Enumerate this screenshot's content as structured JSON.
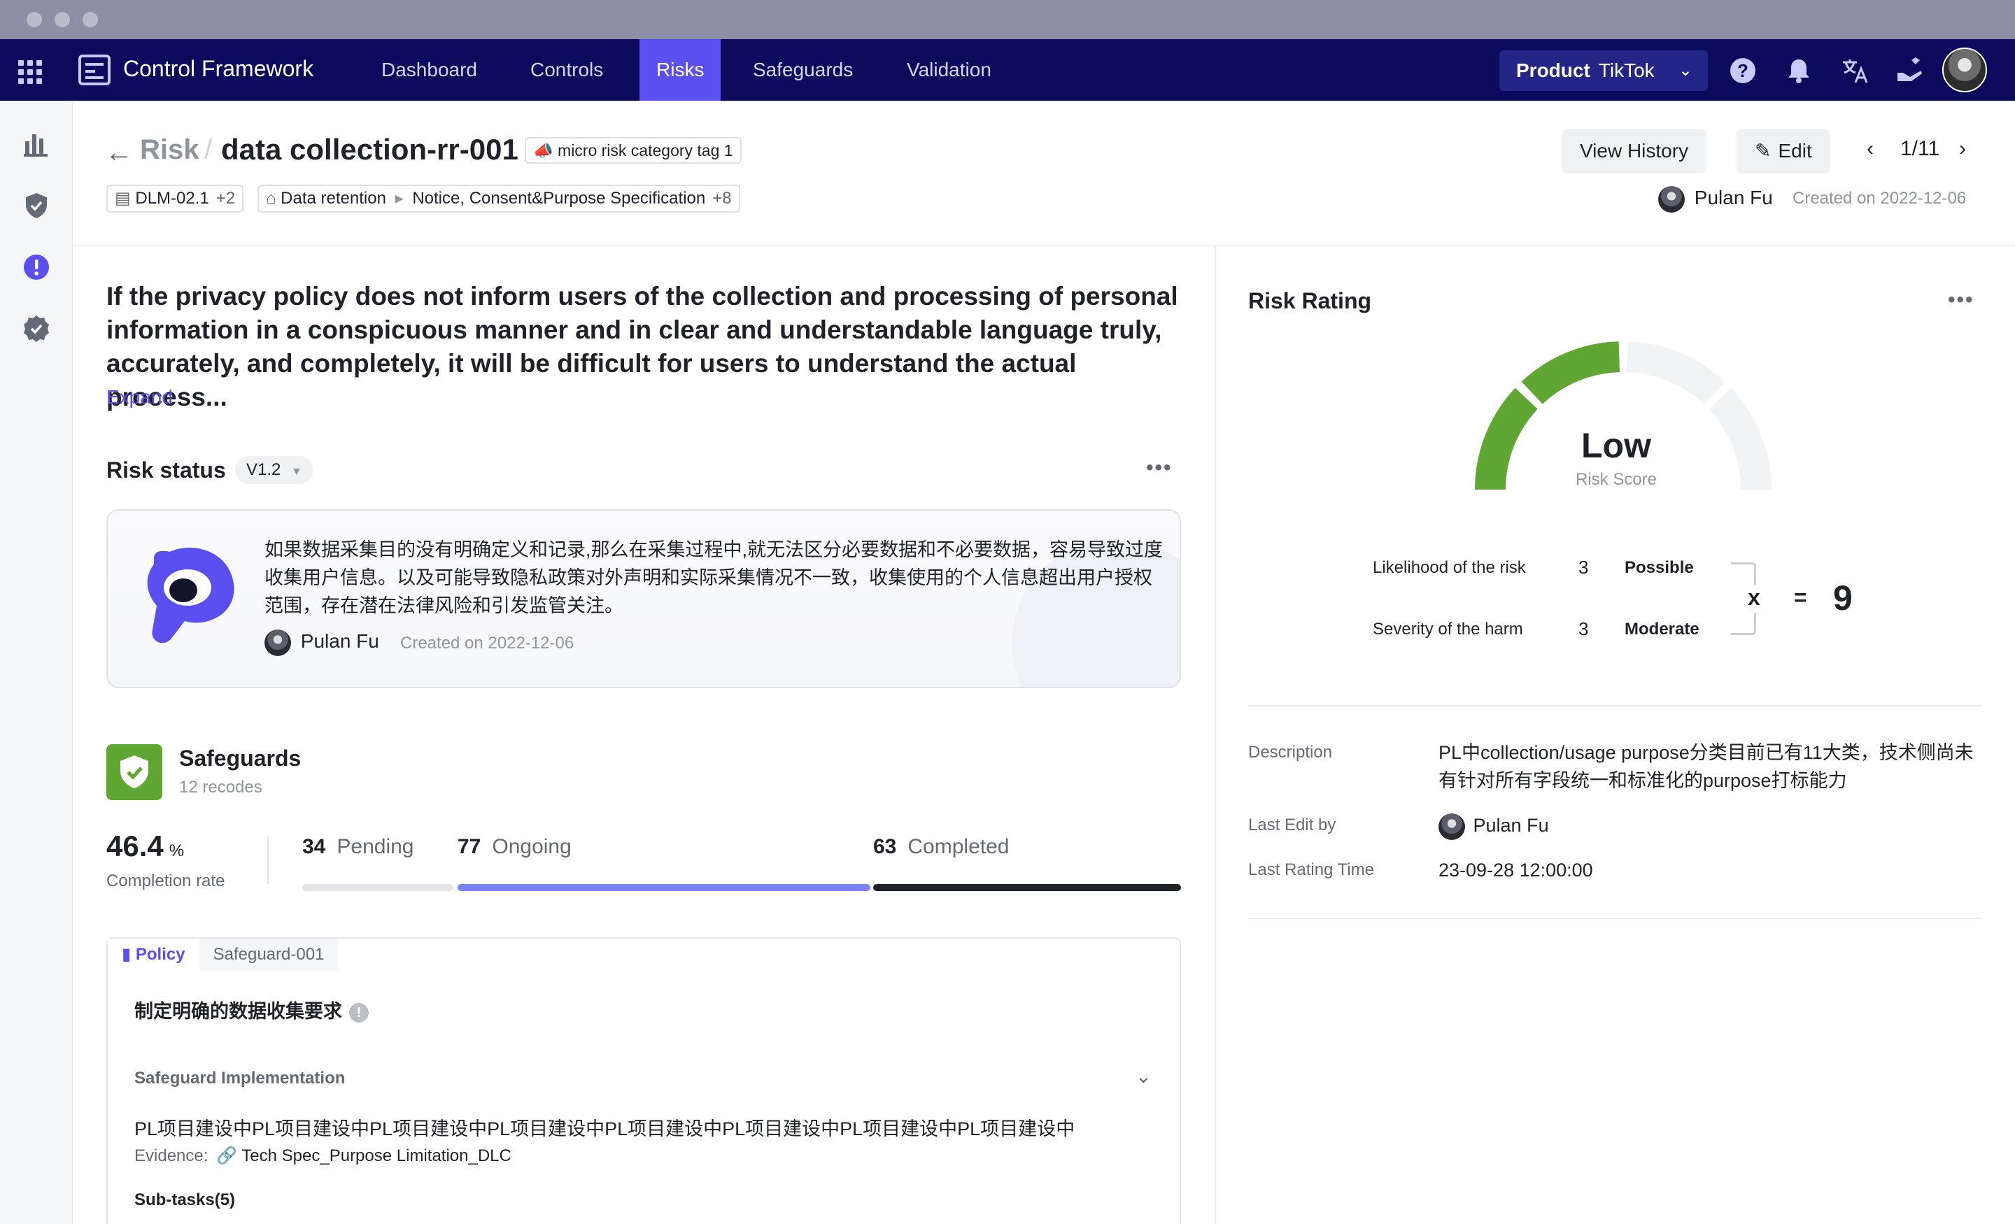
{
  "nav": {
    "app_name": "Control Framework",
    "tabs": [
      "Dashboard",
      "Controls",
      "Risks",
      "Safeguards",
      "Validation"
    ],
    "active_tab": "Risks",
    "product_label": "Product",
    "product_value": "TikTok"
  },
  "header": {
    "root": "Risk",
    "title": "data collection-rr-001",
    "category_tag": "micro risk category tag 1",
    "control_tag": "DLM-02.1",
    "control_tag_more": "+2",
    "path_start": "Data retention",
    "path_end": "Notice, Consent&Purpose Specification",
    "path_more": "+8",
    "view_history": "View History",
    "edit": "Edit",
    "pager": "1/11",
    "author": "Pulan Fu",
    "created": "Created on 2022-12-06"
  },
  "risk": {
    "description": "If the privacy policy does not inform users of the collection and processing of personal information in a conspicuous manner and in clear and understandable language truly, accurately, and completely, it will be difficult for users to understand the actual process...",
    "expand": "Expand"
  },
  "status": {
    "title": "Risk status",
    "version": "V1.2",
    "text": "如果数据采集目的没有明确定义和记录,那么在采集过程中,就无法区分必要数据和不必要数据，容易导致过度收集用户信息。以及可能导致隐私政策对外声明和实际采集情况不一致，收集使用的个人信息超出用户授权范围，存在潜在法律风险和引发监管关注。",
    "author": "Pulan Fu",
    "created": "Created on 2022-12-06"
  },
  "safeguards": {
    "title": "Safeguards",
    "subtitle": "12 recodes",
    "completion_value": "46.4",
    "completion_unit": "%",
    "completion_label": "Completion rate",
    "pending_count": "34",
    "pending_label": "Pending",
    "ongoing_count": "77",
    "ongoing_label": "Ongoing",
    "completed_count": "63",
    "completed_label": "Completed",
    "policy_tab": "Policy",
    "safeguard_id": "Safeguard-001",
    "policy_heading": "制定明确的数据收集要求",
    "impl_label": "Safeguard Implementation",
    "impl_text": "PL项目建设中PL项目建设中PL项目建设中PL项目建设中PL项目建设中PL项目建设中PL项目建设中PL项目建设中",
    "evidence_label": "Evidence:",
    "evidence_value": "Tech Spec_Purpose Limitation_DLC",
    "subtasks": "Sub-tasks(5)"
  },
  "rating": {
    "title": "Risk Rating",
    "level": "Low",
    "score_label": "Risk Score",
    "likelihood_label": "Likelihood of the risk",
    "likelihood_value": "3",
    "likelihood_word": "Possible",
    "severity_label": "Severity of the harm",
    "severity_value": "3",
    "severity_word": "Moderate",
    "times": "x",
    "equals": "=",
    "result": "9",
    "gauge_fraction": 0.25,
    "description_label": "Description",
    "description_value": "PL中collection/usage purpose分类目前已有11大类，技术侧尚未有针对所有字段统一和标准化的purpose打标能力",
    "last_edit_label": "Last Edit by",
    "last_edit_value": "Pulan Fu",
    "last_time_label": "Last Rating Time",
    "last_time_value": "23-09-28 12:00:00"
  },
  "colors": {
    "nav_bg": "#0b0a5c",
    "accent": "#5b4ff0",
    "gauge_green": "#5fa632",
    "ongoing_bar": "#7b83f6",
    "completed_bar": "#1f2329"
  }
}
